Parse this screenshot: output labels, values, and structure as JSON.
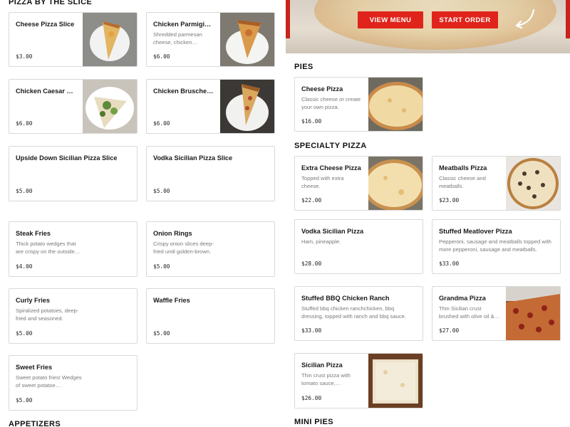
{
  "sections": {
    "pizza_by_slice": "PIZZA BY THE SLICE",
    "pies": "PIES",
    "specialty": "SPECIALTY PIZZA",
    "appetizers": "APPETIZERS",
    "mini_pies": "MINI PIES"
  },
  "hero": {
    "view_menu": "VIEW MENU",
    "start_order": "START ORDER"
  },
  "slices": [
    {
      "name": "Cheese Pizza Slice",
      "desc": "",
      "price": "$3.00"
    },
    {
      "name": "Chicken Parmigiana…",
      "desc": "Shredded parmesan cheese, chicken breast,…",
      "price": "$6.00"
    },
    {
      "name": "Chicken Caesar Pizza…",
      "desc": "",
      "price": "$6.00"
    },
    {
      "name": "Chicken Bruschetta…",
      "desc": "",
      "price": "$6.00"
    },
    {
      "name": "Upside Down Sicilian Pizza Slice",
      "desc": "",
      "price": "$5.00"
    },
    {
      "name": "Vodka Sicilian Pizza Slice",
      "desc": "",
      "price": "$5.00"
    }
  ],
  "sides": [
    {
      "name": "Steak Fries",
      "desc": "Thick potato wedges that are crispy on the outside…",
      "price": "$4.00"
    },
    {
      "name": "Onion Rings",
      "desc": "Crispy onion slices deep-fried until golden-brown.",
      "price": "$5.00"
    },
    {
      "name": "Curly Fries",
      "desc": "Spiralized potatoes, deep-fried and seasoned.",
      "price": "$5.00"
    },
    {
      "name": "Waffle Fries",
      "desc": "",
      "price": "$5.00"
    },
    {
      "name": "Sweet Fries",
      "desc": "Sweet potato fries! Wedges of sweet potatoe…",
      "price": "$5.00"
    }
  ],
  "pies": [
    {
      "name": "Cheese Pizza",
      "desc": "Classic cheese or create your own pizza.",
      "price": "$16.00"
    }
  ],
  "specialty": [
    {
      "name": "Extra Cheese Pizza",
      "desc": "Topped with extra cheese.",
      "price": "$22.00"
    },
    {
      "name": "Meatballs Pizza",
      "desc": "Classic cheese and meatballs.",
      "price": "$23.00"
    },
    {
      "name": "Vodka Sicilian Pizza",
      "desc": "Ham, pineapple.",
      "price": "$28.00"
    },
    {
      "name": "Stuffed Meatlover Pizza",
      "desc": "Pepperoni, sausage and meatballs topped with more pepperoni, sausage and meatballs.",
      "price": "$33.00"
    },
    {
      "name": "Stuffed BBQ Chicken Ranch",
      "desc": "Stuffed bbq chicken ranchchicken, bbq dressing, topped with ranch and bbq sauce.",
      "price": "$33.00"
    },
    {
      "name": "Grandma Pizza",
      "desc": "Thin Sicilian crust brushed with olive oil & garlic,…",
      "price": "$27.00"
    },
    {
      "name": "Sicilian Pizza",
      "desc": "Thin crust pizza with tomato sauce, mozzarell…",
      "price": "$26.00"
    }
  ]
}
